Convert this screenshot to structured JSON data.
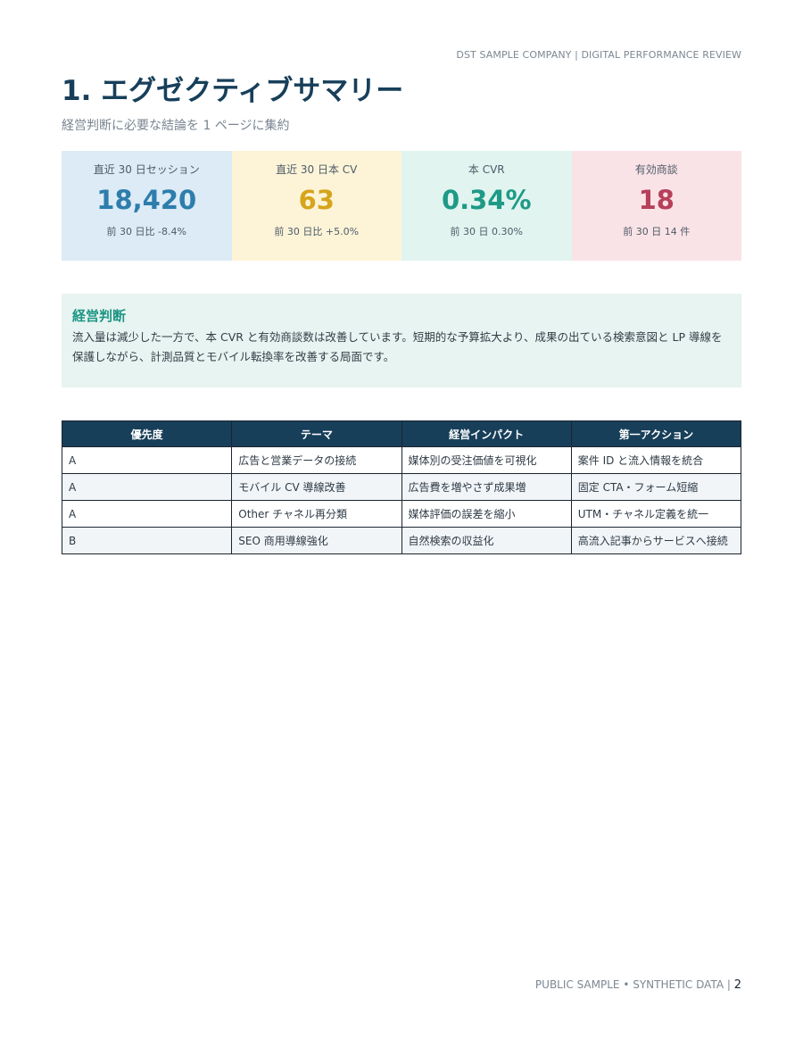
{
  "header": {
    "note": "DST SAMPLE COMPANY | DIGITAL PERFORMANCE REVIEW"
  },
  "page": {
    "title": "1. エグゼクティブサマリー",
    "subtitle": "経営判断に必要な結論を 1 ページに集約"
  },
  "kpis": [
    {
      "label": "直近 30 日セッション",
      "value": "18,420",
      "note": "前 30 日比 -8.4%",
      "color": "#2d7dad",
      "bg": "#dcebf5"
    },
    {
      "label": "直近 30 日本 CV",
      "value": "63",
      "note": "前 30 日比 +5.0%",
      "color": "#d6a51c",
      "bg": "#fdf4d8"
    },
    {
      "label": "本 CVR",
      "value": "0.34%",
      "note": "前 30 日 0.30%",
      "color": "#1e9a86",
      "bg": "#e1f4f0"
    },
    {
      "label": "有効商談",
      "value": "18",
      "note": "前 30 日 14 件",
      "color": "#b6405a",
      "bg": "#fae3e7"
    }
  ],
  "decision": {
    "title": "経営判断",
    "body": "流入量は減少した一方で、本 CVR と有効商談数は改善しています。短期的な予算拡大より、成果の出ている検索意図と LP 導線を保護しながら、計測品質とモバイル転換率を改善する局面です。"
  },
  "table": {
    "headers": [
      "優先度",
      "テーマ",
      "経営インパクト",
      "第一アクション"
    ],
    "rows": [
      [
        "A",
        "広告と営業データの接続",
        "媒体別の受注価値を可視化",
        "案件 ID と流入情報を統合"
      ],
      [
        "A",
        "モバイル CV 導線改善",
        "広告費を増やさず成果増",
        "固定 CTA・フォーム短縮"
      ],
      [
        "A",
        "Other チャネル再分類",
        "媒体評価の誤差を縮小",
        "UTM・チャネル定義を統一"
      ],
      [
        "B",
        "SEO 商用導線強化",
        "自然検索の収益化",
        "高流入記事からサービスへ接続"
      ]
    ]
  },
  "footer": {
    "text": "PUBLIC SAMPLE • SYNTHETIC DATA | ",
    "page_number": "2"
  }
}
